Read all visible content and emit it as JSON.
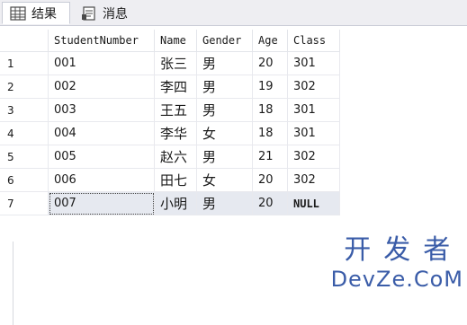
{
  "tabs": [
    {
      "label": "结果",
      "icon": "grid-icon",
      "active": true
    },
    {
      "label": "消息",
      "icon": "messages-icon",
      "active": false
    }
  ],
  "columns": [
    "",
    "StudentNumber",
    "Name",
    "Gender",
    "Age",
    "Class"
  ],
  "rows": [
    {
      "n": "1",
      "StudentNumber": "001",
      "Name": "张三",
      "Gender": "男",
      "Age": "20",
      "Class": "301"
    },
    {
      "n": "2",
      "StudentNumber": "002",
      "Name": "李四",
      "Gender": "男",
      "Age": "19",
      "Class": "302"
    },
    {
      "n": "3",
      "StudentNumber": "003",
      "Name": "王五",
      "Gender": "男",
      "Age": "18",
      "Class": "301"
    },
    {
      "n": "4",
      "StudentNumber": "004",
      "Name": "李华",
      "Gender": "女",
      "Age": "18",
      "Class": "301"
    },
    {
      "n": "5",
      "StudentNumber": "005",
      "Name": "赵六",
      "Gender": "男",
      "Age": "21",
      "Class": "302"
    },
    {
      "n": "6",
      "StudentNumber": "006",
      "Name": "田七",
      "Gender": "女",
      "Age": "20",
      "Class": "302"
    },
    {
      "n": "7",
      "StudentNumber": "007",
      "Name": "小明",
      "Gender": "男",
      "Age": "20",
      "Class": "NULL"
    }
  ],
  "watermark": {
    "top": "开发者",
    "bottom": "DevZe.CoM"
  },
  "colors": {
    "selected_row": "#e6e9f0",
    "watermark": "#3a5ca8",
    "tab_bg": "#eeeef2"
  }
}
